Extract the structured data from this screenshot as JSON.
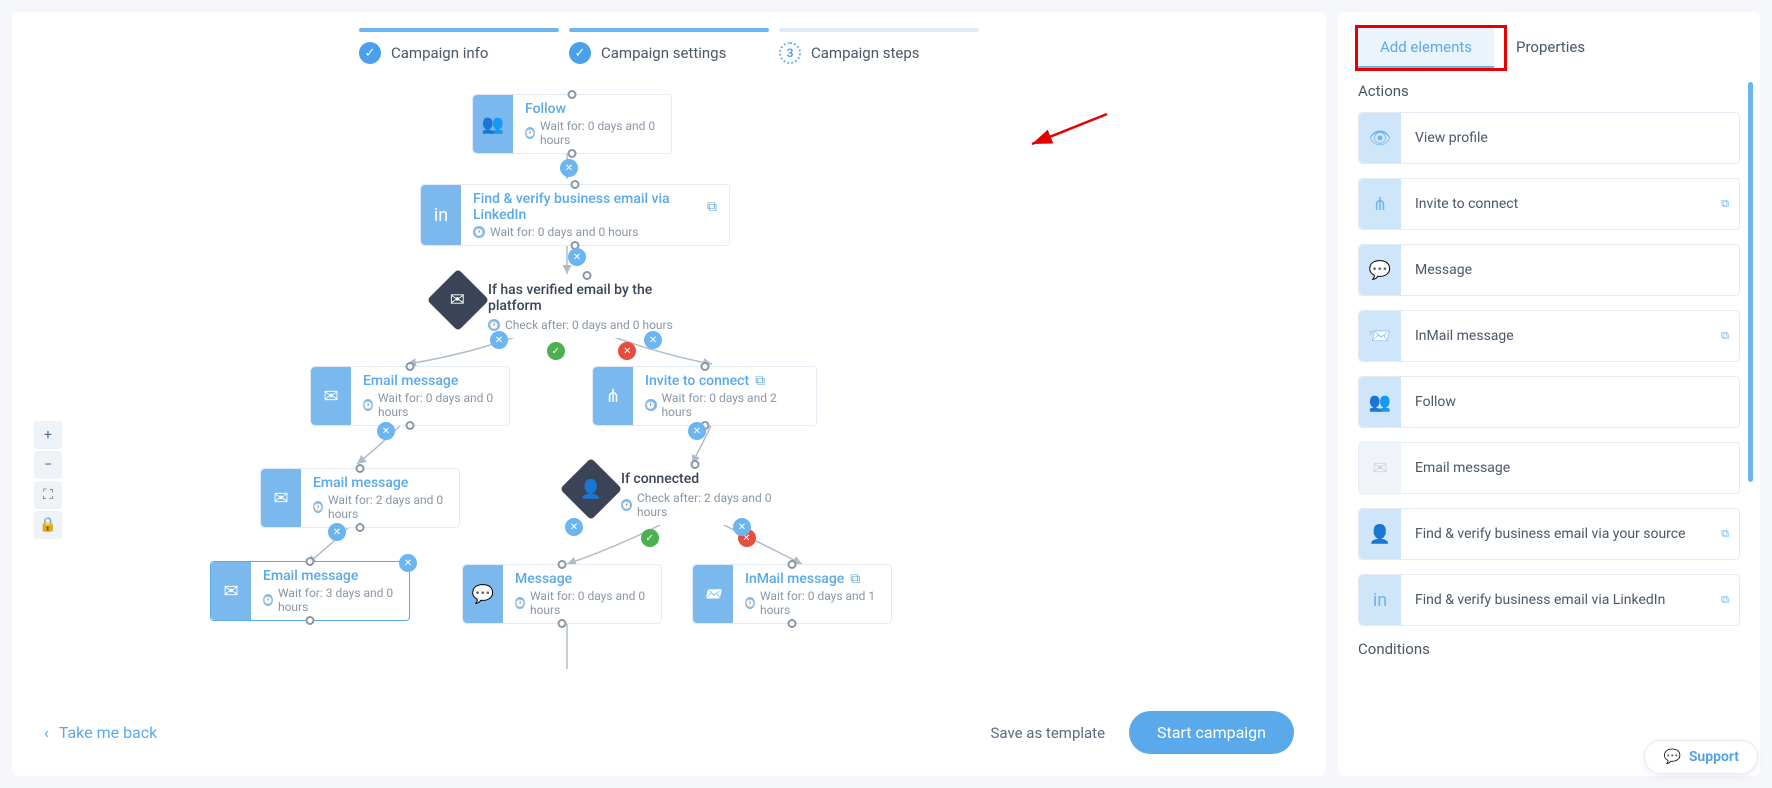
{
  "steps": {
    "s1": {
      "label": "Campaign info"
    },
    "s2": {
      "label": "Campaign settings"
    },
    "s3": {
      "label": "Campaign steps",
      "num": "3"
    }
  },
  "nodes": {
    "follow": {
      "title": "Follow",
      "sub": "Wait for: 0 days and 0 hours"
    },
    "findli": {
      "title": "Find & verify business email via LinkedIn",
      "sub": "Wait for: 0 days and 0 hours"
    },
    "ifemail": {
      "title": "If has verified email by the platform",
      "sub": "Check after: 0 days and 0 hours"
    },
    "email1": {
      "title": "Email message",
      "sub": "Wait for: 0 days and 0 hours"
    },
    "invite": {
      "title": "Invite to connect",
      "sub": "Wait for: 0 days and 2 hours"
    },
    "email2": {
      "title": "Email message",
      "sub": "Wait for: 2 days and 0 hours"
    },
    "ifconn": {
      "title": "If connected",
      "sub": "Check after: 2 days and 0 hours"
    },
    "email3": {
      "title": "Email message",
      "sub": "Wait for: 3 days and 0 hours"
    },
    "msg": {
      "title": "Message",
      "sub": "Wait for: 0 days and 0 hours"
    },
    "inmail": {
      "title": "InMail message",
      "sub": "Wait for: 0 days and 1 hours"
    }
  },
  "footer": {
    "back": "Take me back",
    "save": "Save as template",
    "start": "Start campaign"
  },
  "sidebar": {
    "tabs": {
      "add": "Add elements",
      "props": "Properties"
    },
    "sections": {
      "actions": "Actions",
      "conditions": "Conditions"
    },
    "actions": {
      "view": "View profile",
      "invite": "Invite to connect",
      "message": "Message",
      "inmail": "InMail message",
      "follow": "Follow",
      "emailmsg": "Email message",
      "findsrc": "Find & verify business email via your source",
      "findli": "Find & verify business email via LinkedIn"
    }
  },
  "support": "Support"
}
